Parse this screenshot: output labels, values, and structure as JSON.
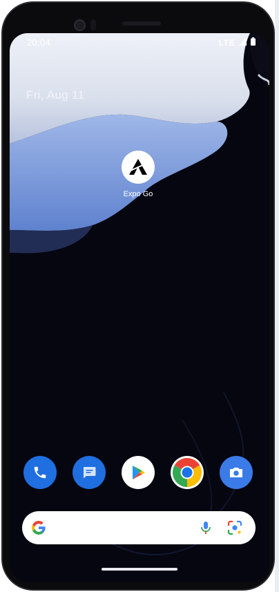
{
  "status_bar": {
    "time": "20:04",
    "network": "LTE"
  },
  "home": {
    "date": "Fri, Aug 11"
  },
  "apps": [
    {
      "label": "Expo Go",
      "icon": "expo-go-icon"
    }
  ],
  "dock": [
    {
      "icon": "phone-icon",
      "color": "#1f6fe0"
    },
    {
      "icon": "messages-icon",
      "color": "#1f6fe0"
    },
    {
      "icon": "play-store-icon",
      "color": "#ffffff"
    },
    {
      "icon": "chrome-icon",
      "color": "#ffffff"
    },
    {
      "icon": "camera-icon",
      "color": "#3b7be8"
    }
  ],
  "search_bar": {
    "icons": [
      "google-g-icon",
      "microphone-icon",
      "lens-icon"
    ]
  },
  "colors": {
    "wallpaper_light": "#dfe4ef",
    "wallpaper_blue": "#7e9fe0",
    "wallpaper_dark": "#050610"
  }
}
